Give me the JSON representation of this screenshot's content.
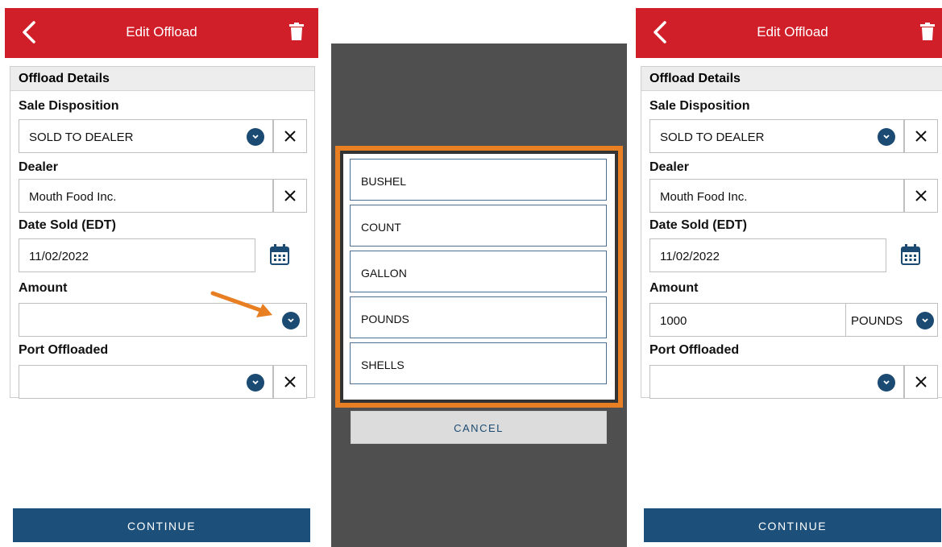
{
  "screen1": {
    "title": "Edit Offload",
    "section_title": "Offload Details",
    "sale_disposition_label": "Sale Disposition",
    "sale_disposition_value": "SOLD TO DEALER",
    "dealer_label": "Dealer",
    "dealer_value": "Mouth Food Inc.",
    "date_label": "Date Sold (EDT)",
    "date_value": "11/02/2022",
    "amount_label": "Amount",
    "amount_value": "",
    "port_label": "Port Offloaded",
    "port_value": "",
    "continue_label": "CONTINUE"
  },
  "screen2": {
    "options": [
      "BUSHEL",
      "COUNT",
      "GALLON",
      "POUNDS",
      "SHELLS"
    ],
    "cancel_label": "CANCEL"
  },
  "screen3": {
    "title": "Edit Offload",
    "section_title": "Offload Details",
    "sale_disposition_label": "Sale Disposition",
    "sale_disposition_value": "SOLD TO DEALER",
    "dealer_label": "Dealer",
    "dealer_value": "Mouth Food Inc.",
    "date_label": "Date Sold (EDT)",
    "date_value": "11/02/2022",
    "amount_label": "Amount",
    "amount_value": "1000",
    "amount_unit": "POUNDS",
    "port_label": "Port Offloaded",
    "port_value": "",
    "continue_label": "CONTINUE"
  },
  "colors": {
    "header_red": "#d11f2a",
    "primary_blue": "#1c4f7a",
    "highlight_orange": "#e87f22",
    "overlay_gray": "#4f4f4f"
  },
  "icons": [
    "back-chevron-icon",
    "trash-icon",
    "dropdown-chevron-icon",
    "clear-x-icon",
    "calendar-icon",
    "pointer-arrow-icon"
  ]
}
